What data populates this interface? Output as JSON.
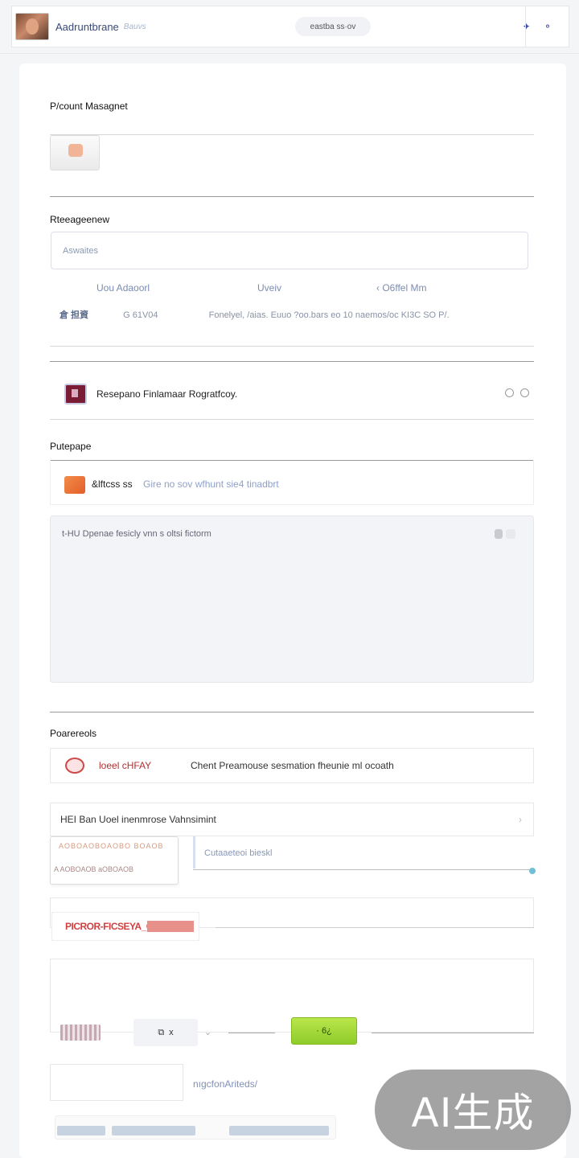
{
  "header": {
    "app_title": "Aadruntbrane",
    "app_subtitle": "Bauvs",
    "center_pill": "eastba ss·ov",
    "icon_left": "bell-icon",
    "icon_right": "search-icon"
  },
  "sections": {
    "account": {
      "title": "P/count Masagnet"
    },
    "resources": {
      "title": "Rteeageenew",
      "search_placeholder": "Aswaites",
      "columns": [
        "Uou Adaoorl",
        "Uveiv",
        "‹ O6ffel Mm"
      ],
      "meta_prefix": "倉 担資",
      "meta_code": "G 61V04",
      "meta_text": "Fonelyel, /aias. Euuo ?oo.bars eo 10 naemos/oc KI3C SO P/."
    },
    "record": {
      "label": "Resepano Finlamaar Rogratfcoy.",
      "icon": "document-icon"
    },
    "purpose": {
      "title": "Putepape",
      "tag": "&lftcss ss",
      "text": "Gire no sov wfhunt sie4 tinadbrt",
      "textarea_text": "t-HU Dpenae fesicly vnn s oltsi fictorm"
    },
    "permissions": {
      "title": "Poarereols",
      "row1_tag": "loeel cHFAY",
      "row1_text": "Chent Preamouse sesmation fheunie ml ocoath",
      "row2_text": "HEI Ban Uoel inenmrose Vahnsimint",
      "dropdown_line1": "AOBOAOBOAOBO BOAOB",
      "dropdown_line2": "A AOBOAOB aOBOAOB",
      "sub_field": "Cutaaeteoi bieskl",
      "red_tag": "PICROR-FICSEYA_CTER",
      "btn_text": "x",
      "green_btn": "· 6¿",
      "bottom_label": "nıgcfonAriteds/"
    }
  },
  "watermark": "AI生成",
  "colors": {
    "accent": "#3a4a7a",
    "green": "#a6d93a",
    "red": "#d04040"
  }
}
